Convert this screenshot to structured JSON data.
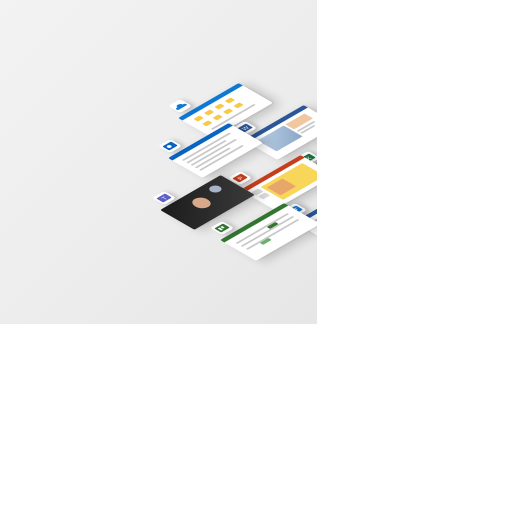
{
  "hero": {
    "background": "#eeeeee",
    "accent_colors": {
      "onedrive": "#0f78d4",
      "outlook": "#0a64c2",
      "word": "#2b579a",
      "powerpoint": "#c43e1c",
      "excel": "#217346",
      "teams": "#5b5fc7",
      "planner": "#31752f"
    }
  },
  "app_tiles": [
    {
      "app": "onedrive",
      "icon": "cloud-icon"
    },
    {
      "app": "word",
      "icon": "word-icon"
    },
    {
      "app": "outlook",
      "icon": "outlook-icon"
    },
    {
      "app": "excel",
      "icon": "excel-icon"
    },
    {
      "app": "powerpoint",
      "icon": "powerpoint-icon"
    },
    {
      "app": "teams",
      "icon": "teams-icon"
    },
    {
      "app": "word-doc",
      "icon": "document-icon"
    },
    {
      "app": "planner",
      "icon": "planner-icon"
    }
  ]
}
